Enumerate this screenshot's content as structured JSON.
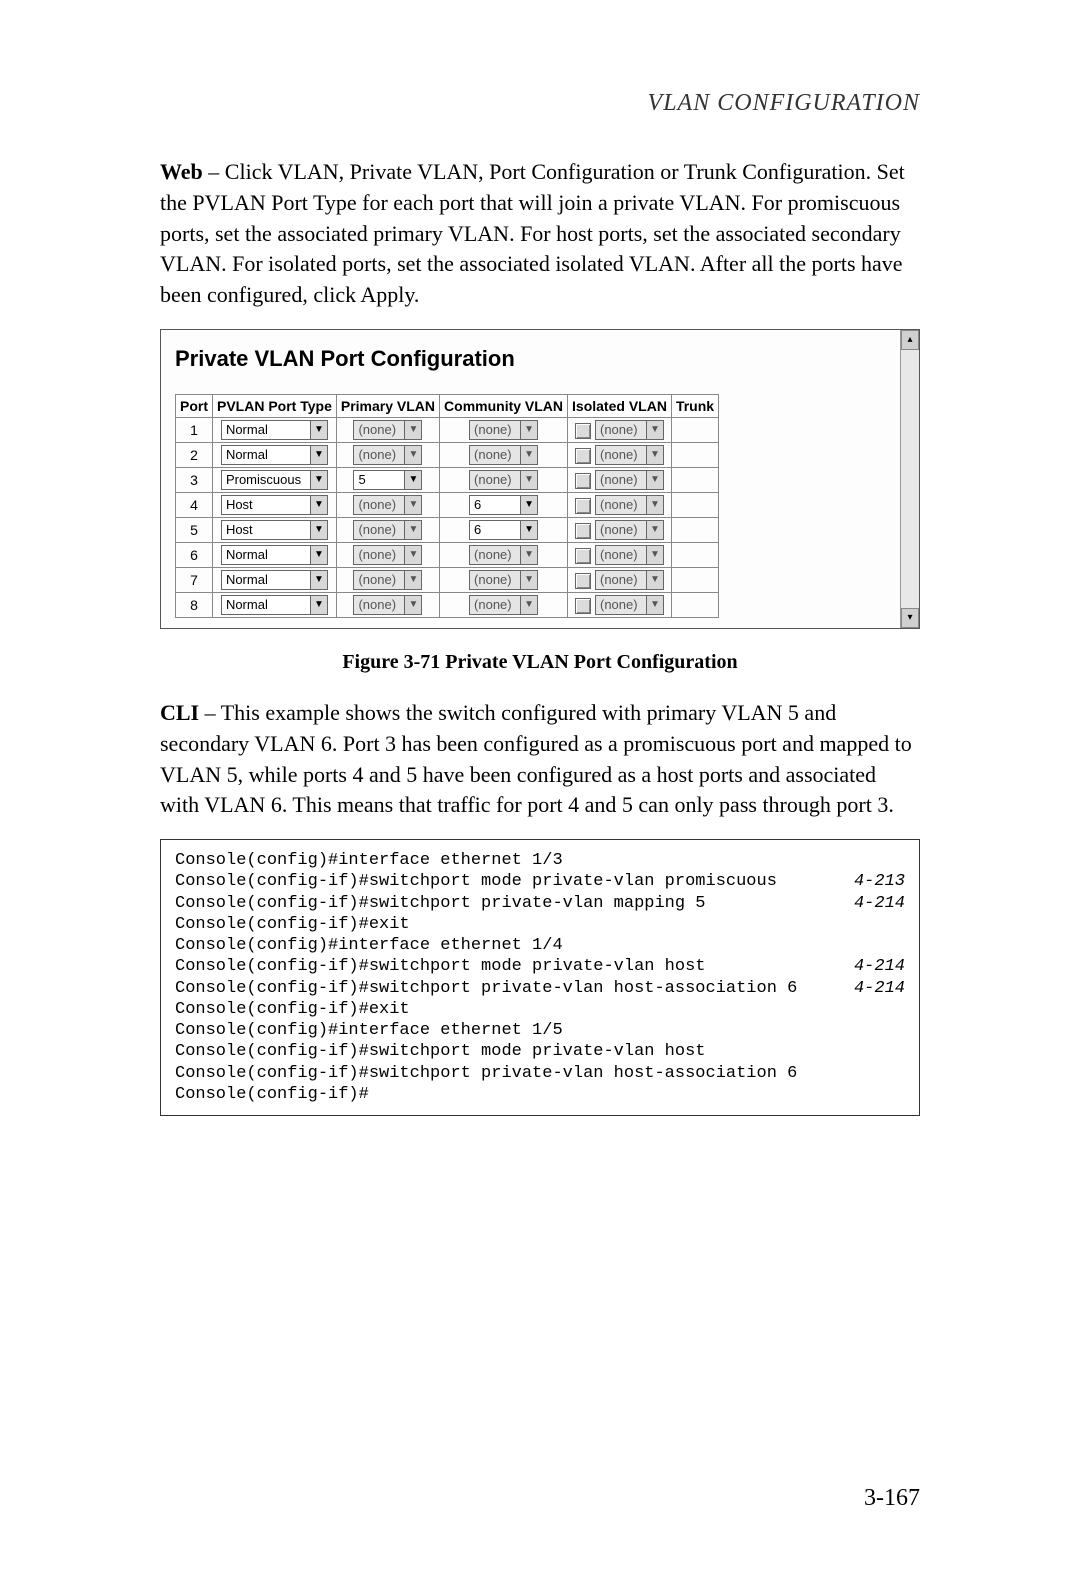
{
  "running_head": "VLAN CONFIGURATION",
  "para_web_lead": "Web",
  "para_web": " – Click VLAN, Private VLAN, Port Configuration or Trunk Configuration. Set the PVLAN Port Type for each port that will join a private VLAN. For promiscuous ports, set the associated primary VLAN. For host ports, set the associated secondary VLAN. For isolated ports, set the associated isolated VLAN. After all the ports have been configured, click Apply.",
  "figure": {
    "title": "Private VLAN Port Configuration",
    "caption": "Figure 3-71  Private VLAN Port Configuration",
    "headers": {
      "port": "Port",
      "type": "PVLAN Port Type",
      "primary": "Primary VLAN",
      "community": "Community VLAN",
      "isolated": "Isolated VLAN",
      "trunk": "Trunk"
    },
    "rows": [
      {
        "port": "1",
        "type": "Normal",
        "type_enabled": true,
        "primary": "(none)",
        "primary_enabled": false,
        "community": "(none)",
        "community_enabled": false,
        "iso_checked": false,
        "isolated": "(none)",
        "isolated_enabled": false,
        "trunk": ""
      },
      {
        "port": "2",
        "type": "Normal",
        "type_enabled": true,
        "primary": "(none)",
        "primary_enabled": false,
        "community": "(none)",
        "community_enabled": false,
        "iso_checked": false,
        "isolated": "(none)",
        "isolated_enabled": false,
        "trunk": ""
      },
      {
        "port": "3",
        "type": "Promiscuous",
        "type_enabled": true,
        "primary": "5",
        "primary_enabled": true,
        "community": "(none)",
        "community_enabled": false,
        "iso_checked": false,
        "isolated": "(none)",
        "isolated_enabled": false,
        "trunk": ""
      },
      {
        "port": "4",
        "type": "Host",
        "type_enabled": true,
        "primary": "(none)",
        "primary_enabled": false,
        "community": "6",
        "community_enabled": true,
        "iso_checked": false,
        "isolated": "(none)",
        "isolated_enabled": false,
        "trunk": ""
      },
      {
        "port": "5",
        "type": "Host",
        "type_enabled": true,
        "primary": "(none)",
        "primary_enabled": false,
        "community": "6",
        "community_enabled": true,
        "iso_checked": false,
        "isolated": "(none)",
        "isolated_enabled": false,
        "trunk": ""
      },
      {
        "port": "6",
        "type": "Normal",
        "type_enabled": true,
        "primary": "(none)",
        "primary_enabled": false,
        "community": "(none)",
        "community_enabled": false,
        "iso_checked": false,
        "isolated": "(none)",
        "isolated_enabled": false,
        "trunk": ""
      },
      {
        "port": "7",
        "type": "Normal",
        "type_enabled": true,
        "primary": "(none)",
        "primary_enabled": false,
        "community": "(none)",
        "community_enabled": false,
        "iso_checked": false,
        "isolated": "(none)",
        "isolated_enabled": false,
        "trunk": ""
      },
      {
        "port": "8",
        "type": "Normal",
        "type_enabled": true,
        "primary": "(none)",
        "primary_enabled": false,
        "community": "(none)",
        "community_enabled": false,
        "iso_checked": false,
        "isolated": "(none)",
        "isolated_enabled": false,
        "trunk": ""
      }
    ]
  },
  "para_cli_lead": "CLI",
  "para_cli": " – This example shows the switch configured with primary VLAN 5 and secondary VLAN 6. Port 3 has been configured as a promiscuous port and mapped to VLAN 5, while ports 4 and 5 have been configured as a host ports and associated with VLAN 6. This means that traffic for port 4 and 5 can only pass through port 3.",
  "cli": [
    {
      "cmd": "Console(config)#interface ethernet 1/3",
      "ref": ""
    },
    {
      "cmd": "Console(config-if)#switchport mode private-vlan promiscuous",
      "ref": "4-213"
    },
    {
      "cmd": "Console(config-if)#switchport private-vlan mapping 5",
      "ref": "4-214"
    },
    {
      "cmd": "Console(config-if)#exit",
      "ref": ""
    },
    {
      "cmd": "Console(config)#interface ethernet 1/4",
      "ref": ""
    },
    {
      "cmd": "Console(config-if)#switchport mode private-vlan host",
      "ref": "4-214"
    },
    {
      "cmd": "Console(config-if)#switchport private-vlan host-association 6",
      "ref": "4-214"
    },
    {
      "cmd": "Console(config-if)#exit",
      "ref": ""
    },
    {
      "cmd": "Console(config)#interface ethernet 1/5",
      "ref": ""
    },
    {
      "cmd": "Console(config-if)#switchport mode private-vlan host",
      "ref": ""
    },
    {
      "cmd": "Console(config-if)#switchport private-vlan host-association 6",
      "ref": ""
    },
    {
      "cmd": "Console(config-if)#",
      "ref": ""
    }
  ],
  "page_number": "3-167"
}
